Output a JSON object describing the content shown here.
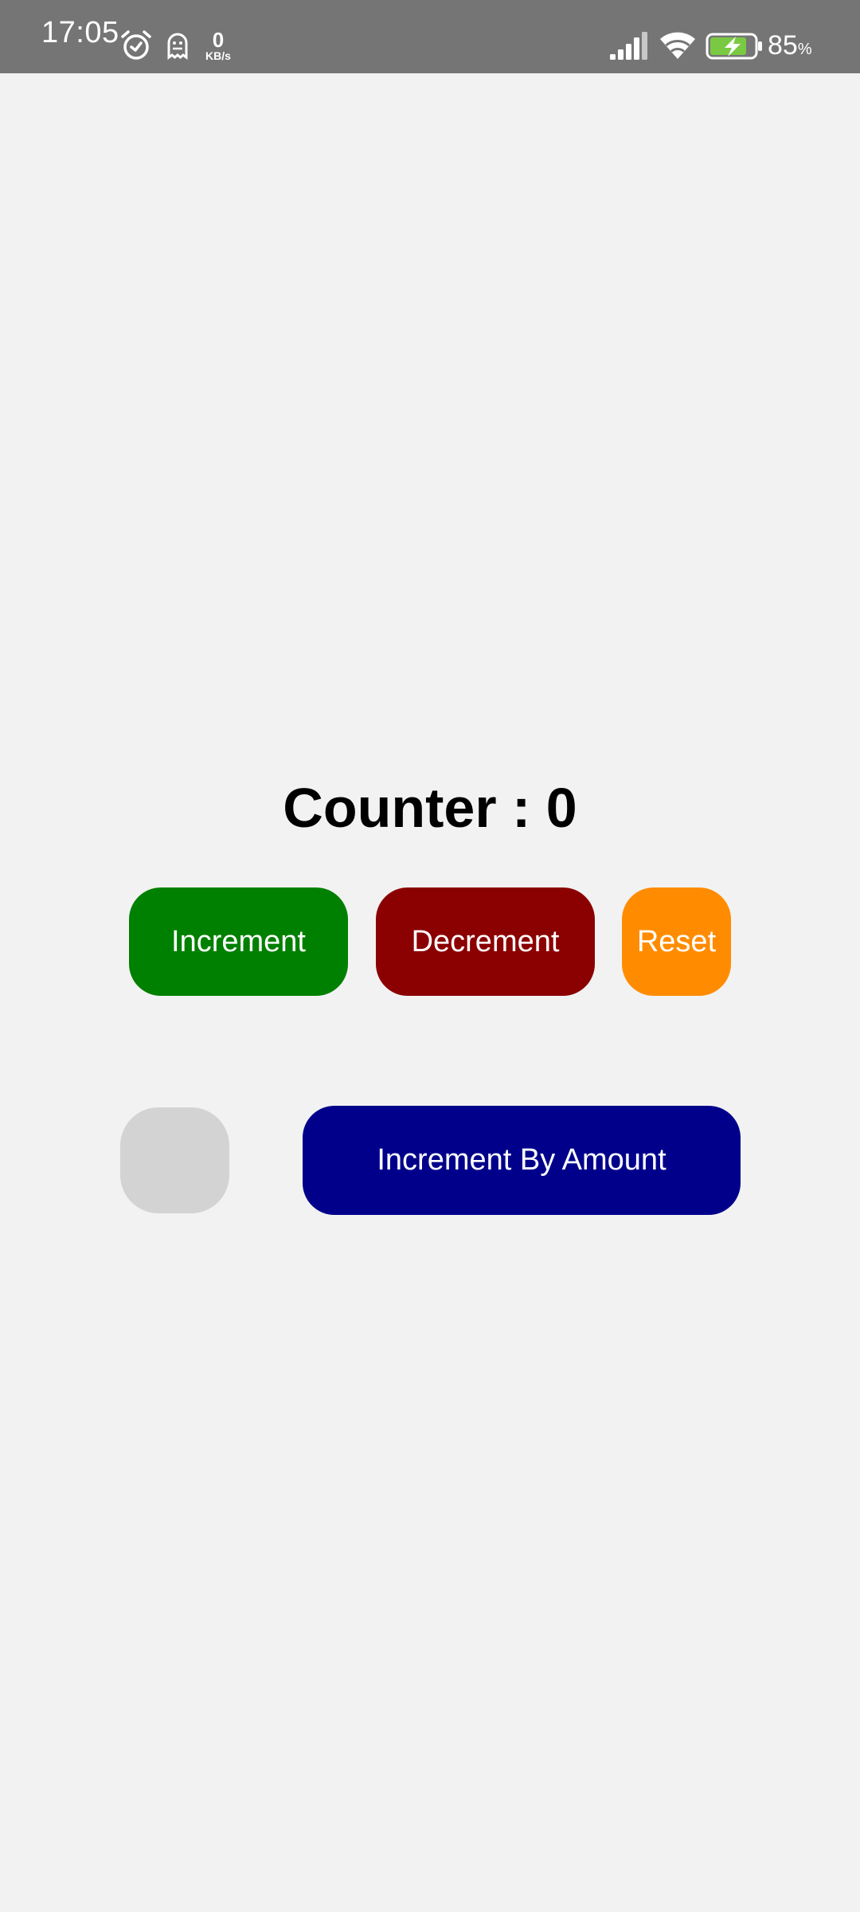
{
  "status_bar": {
    "time": "17:05",
    "net_speed_value": "0",
    "net_speed_unit": "KB/s",
    "battery_percent": "85",
    "battery_percent_sign": "%",
    "icons": [
      "alarm-icon",
      "ghost-notification-icon",
      "signal-icon",
      "wifi-icon",
      "battery-charging-icon"
    ],
    "background_color": "#757575",
    "battery_charge_color": "#7ac943"
  },
  "counter": {
    "label": "Counter : 0"
  },
  "buttons": {
    "increment": {
      "label": "Increment",
      "color": "#008000"
    },
    "decrement": {
      "label": "Decrement",
      "color": "#8b0000"
    },
    "reset": {
      "label": "Reset",
      "color": "#ff8c00"
    },
    "increment_by_amount": {
      "label": "Increment By Amount",
      "color": "#00008b"
    }
  },
  "amount_input": {
    "value": "",
    "placeholder": "",
    "background_color": "#d3d3d3"
  },
  "page": {
    "background_color": "#f2f2f2"
  }
}
